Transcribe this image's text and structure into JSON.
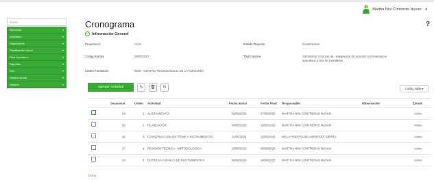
{
  "user": {
    "name": "Martha Nini Contreras Nuvan"
  },
  "help_label": "?",
  "sidebar": {
    "home": "Inicio",
    "items": [
      {
        "label": "Ejecucion"
      },
      {
        "label": "Inventario"
      },
      {
        "label": "Seguimiento"
      },
      {
        "label": "Planificacion Anual"
      },
      {
        "label": "Plan Operativo"
      },
      {
        "label": "Reportes"
      },
      {
        "label": "SGI"
      },
      {
        "label": "Gestion Anual"
      },
      {
        "label": "Usuario"
      }
    ]
  },
  "page": {
    "title": "Cronograma",
    "section": "Información General"
  },
  "info": {
    "proyecto_id_label": "Proyecto Id",
    "proyecto_id_value": "4169",
    "estado_label": "Estado Proyecto",
    "estado_value": "Construcción",
    "codigo_label": "Código Norma",
    "codigo_value": "280601027",
    "titulo_label": "Título Norma",
    "titulo_value_1": "Administrar recursos de - integración de acuerdo con inventarios",
    "titulo_value_2": "operativos y tipo de inventarios",
    "centro_label": "Centro Formación",
    "centro_value": "9226 - CENTRO TECNOLÓGICO DE LA AMAZONÍA"
  },
  "toolbar": {
    "add_label": "Agregar Actividad",
    "edit_icon": "✎",
    "delete_icon": "🗑",
    "history_icon": "↻",
    "config_label": "Config. tabla ▾"
  },
  "table": {
    "headers": {
      "secuencia": "Secuencia",
      "orden": "Orden",
      "actividad": "Actividad",
      "fecha_inicial": "Fecha Inicial",
      "fecha_final": "Fecha Final",
      "responsable": "Responsable",
      "observacion": "Observación",
      "estado": "Estado"
    },
    "rows": [
      {
        "secuencia": "24",
        "orden": "1",
        "actividad": "ALISTAMIENTO",
        "fecha_inicial": "09/05/2025",
        "fecha_final": "07/05/2025",
        "responsable": "MARTHA NINI CONTRERAS NUVAN",
        "observacion": "",
        "estado": "Activo"
      },
      {
        "secuencia": "25",
        "orden": "2",
        "actividad": "PLANEACIÓN",
        "fecha_inicial": "09/05/2025",
        "fecha_final": "10/05/2025",
        "responsable": "MARTHA NINI CONTRERAS NUVAN",
        "observacion": "",
        "estado": "Activo"
      },
      {
        "secuencia": "26",
        "orden": "3",
        "actividad": "CONSTRUCCIÓN DE ÍTEMS Y INSTRUMENTOS",
        "fecha_inicial": "11/05/2025",
        "fecha_final": "15/05/2025",
        "responsable": "NELLY ESPERANZA MENESES SIERRA",
        "observacion": "",
        "estado": "Activo"
      },
      {
        "secuencia": "27",
        "orden": "4",
        "actividad": "REVISIÓN TÉCNICA - METODOLÓGICA",
        "fecha_inicial": "15/05/2025",
        "fecha_final": "06/06/2025",
        "responsable": "MARTHA NINI CONTRERAS NUVAN",
        "observacion": "",
        "estado": "Activo"
      },
      {
        "secuencia": "28",
        "orden": "5",
        "actividad": "ENTREGA A BANCO DE INSTRUMENTOS",
        "fecha_inicial": "06/06/2025",
        "fecha_final": "10/06/2025",
        "responsable": "MARTHA NINI CONTRERAS NUVAN",
        "observacion": "",
        "estado": "Activo"
      }
    ]
  },
  "footer": {
    "close_label": "Cerrar"
  },
  "colors": {
    "accent": "#39a935"
  }
}
